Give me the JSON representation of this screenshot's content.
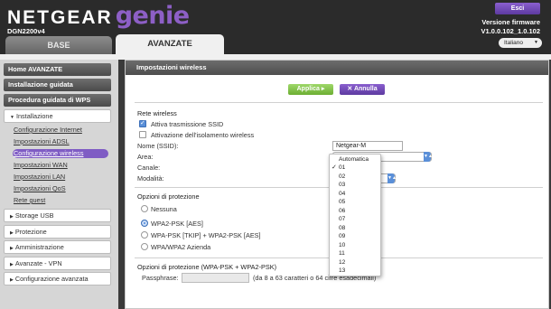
{
  "header": {
    "brand": "NETGEAR",
    "product": "genie",
    "model": "DGN2200v4",
    "exit_label": "Esci",
    "firmware_label": "Versione firmware",
    "firmware_version": "V1.0.0.102_1.0.102",
    "language": "Italiano"
  },
  "tabs": {
    "base": "BASE",
    "advanced": "AVANZATE"
  },
  "sidebar": {
    "home": "Home AVANZATE",
    "installazione_guidata": "Installazione guidata",
    "wps": "Procedura guidata di WPS",
    "installazione": "Installazione",
    "sub_items": [
      "Configurazione Internet",
      "Impostazioni ADSL",
      "Configurazione wireless",
      "Impostazioni WAN",
      "Impostazioni LAN",
      "Impostazioni QoS",
      "Rete guest"
    ],
    "storage": "Storage USB",
    "protezione": "Protezione",
    "amministrazione": "Amministrazione",
    "vpn": "Avanzate - VPN",
    "config_avanzata": "Configurazione avanzata"
  },
  "main": {
    "title": "Impostazioni wireless",
    "apply": "Applica ▸",
    "cancel": "✕ Annulla",
    "wireless_section": "Rete wireless",
    "ssid_broadcast": "Attiva trasmissione SSID",
    "isolation": "Attivazione dell'isolamento wireless",
    "ssid_label": "Nome (SSID):",
    "ssid_value": "Netgear-M",
    "area_label": "Area:",
    "channel_label": "Canale:",
    "mode_label": "Modalità:",
    "security_section": "Opzioni di protezione",
    "sec_options": [
      "Nessuna",
      "WPA2-PSK [AES]",
      "WPA-PSK [TKIP] + WPA2-PSK [AES]",
      "WPA/WPA2 Azienda"
    ],
    "sec_selected": "WPA2-PSK [AES]",
    "psk_section": "Opzioni di protezione (WPA-PSK + WPA2-PSK)",
    "passphrase_label": "Passphrase:",
    "passphrase_hint": "(da 8 a 63 caratteri o 64 cifre esadecimali)"
  },
  "channel_dropdown": {
    "options": [
      "Automatica",
      "01",
      "02",
      "03",
      "04",
      "05",
      "06",
      "07",
      "08",
      "09",
      "10",
      "11",
      "12",
      "13"
    ],
    "selected": "01"
  },
  "colors": {
    "accent_purple": "#7f5cc4",
    "apply_green": "#6cae32",
    "header_dark": "#2b2b2b"
  }
}
